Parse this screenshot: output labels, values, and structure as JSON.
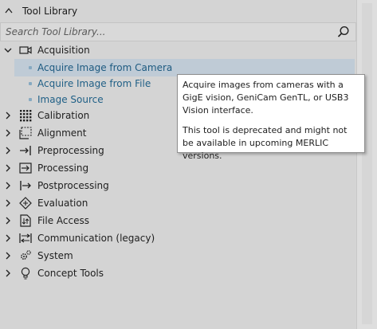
{
  "panel": {
    "title": "Tool Library",
    "search": {
      "placeholder": "Search Tool Library..."
    }
  },
  "categories": [
    {
      "label": "Acquisition",
      "expanded": true,
      "icon": "camera-icon",
      "children": [
        {
          "label": "Acquire Image from Camera",
          "selected": true
        },
        {
          "label": "Acquire Image from File",
          "selected": false
        },
        {
          "label": "Image Source",
          "selected": false
        }
      ]
    },
    {
      "label": "Calibration",
      "icon": "calibration-grid-icon"
    },
    {
      "label": "Alignment",
      "icon": "alignment-icon"
    },
    {
      "label": "Preprocessing",
      "icon": "preprocessing-icon"
    },
    {
      "label": "Processing",
      "icon": "processing-icon"
    },
    {
      "label": "Postprocessing",
      "icon": "postprocessing-icon"
    },
    {
      "label": "Evaluation",
      "icon": "evaluation-icon"
    },
    {
      "label": "File Access",
      "icon": "file-access-icon"
    },
    {
      "label": "Communication (legacy)",
      "icon": "communication-icon"
    },
    {
      "label": "System",
      "icon": "gears-icon"
    },
    {
      "label": "Concept Tools",
      "icon": "lightbulb-icon"
    }
  ],
  "tooltip": {
    "line1": "Acquire images from cameras with a GigE vision, GeniCam GenTL, or USB3 Vision interface.",
    "line2": "This tool is deprecated and might not be available in upcoming MERLIC versions."
  },
  "colors": {
    "background": "#d4d4d4",
    "selected_row": "#bfcbd6",
    "link_text": "#1f5f86"
  }
}
